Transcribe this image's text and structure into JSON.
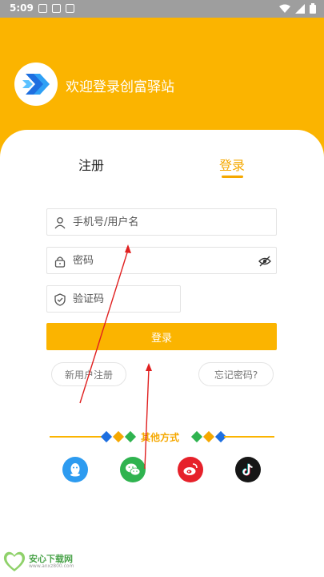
{
  "status_bar": {
    "time": "5:09",
    "left_icons": [
      "notification-icon",
      "image-icon",
      "download-icon"
    ],
    "right_icons": [
      "wifi-icon",
      "signal-icon",
      "battery-icon"
    ]
  },
  "header": {
    "title": "欢迎登录创富驿站",
    "logo_icon": "app-logo-icon"
  },
  "tabs": {
    "register": "注册",
    "login": "登录",
    "active": "login"
  },
  "form": {
    "username": {
      "placeholder": "手机号/用户名",
      "value": "",
      "icon": "user-icon"
    },
    "password": {
      "placeholder": "密码",
      "value": "",
      "icon": "lock-icon",
      "toggle_icon": "eye-icon"
    },
    "captcha": {
      "placeholder": "验证码",
      "value": "",
      "icon": "shield-icon"
    },
    "submit_label": "登录",
    "new_user_label": "新用户注册",
    "forgot_label": "忘记密码?"
  },
  "other_login": {
    "label": "其他方式",
    "providers": [
      {
        "name": "qq-icon"
      },
      {
        "name": "wechat-icon"
      },
      {
        "name": "weibo-icon"
      },
      {
        "name": "douyin-icon"
      }
    ]
  },
  "watermark": {
    "name": "安心下载网",
    "url": "www.anxz800.com",
    "badge_text": "安心"
  },
  "colors": {
    "brand": "#fbb400",
    "accent_text": "#f5a800",
    "status_bar": "#9e9e9e",
    "annotation": "#e02020"
  }
}
